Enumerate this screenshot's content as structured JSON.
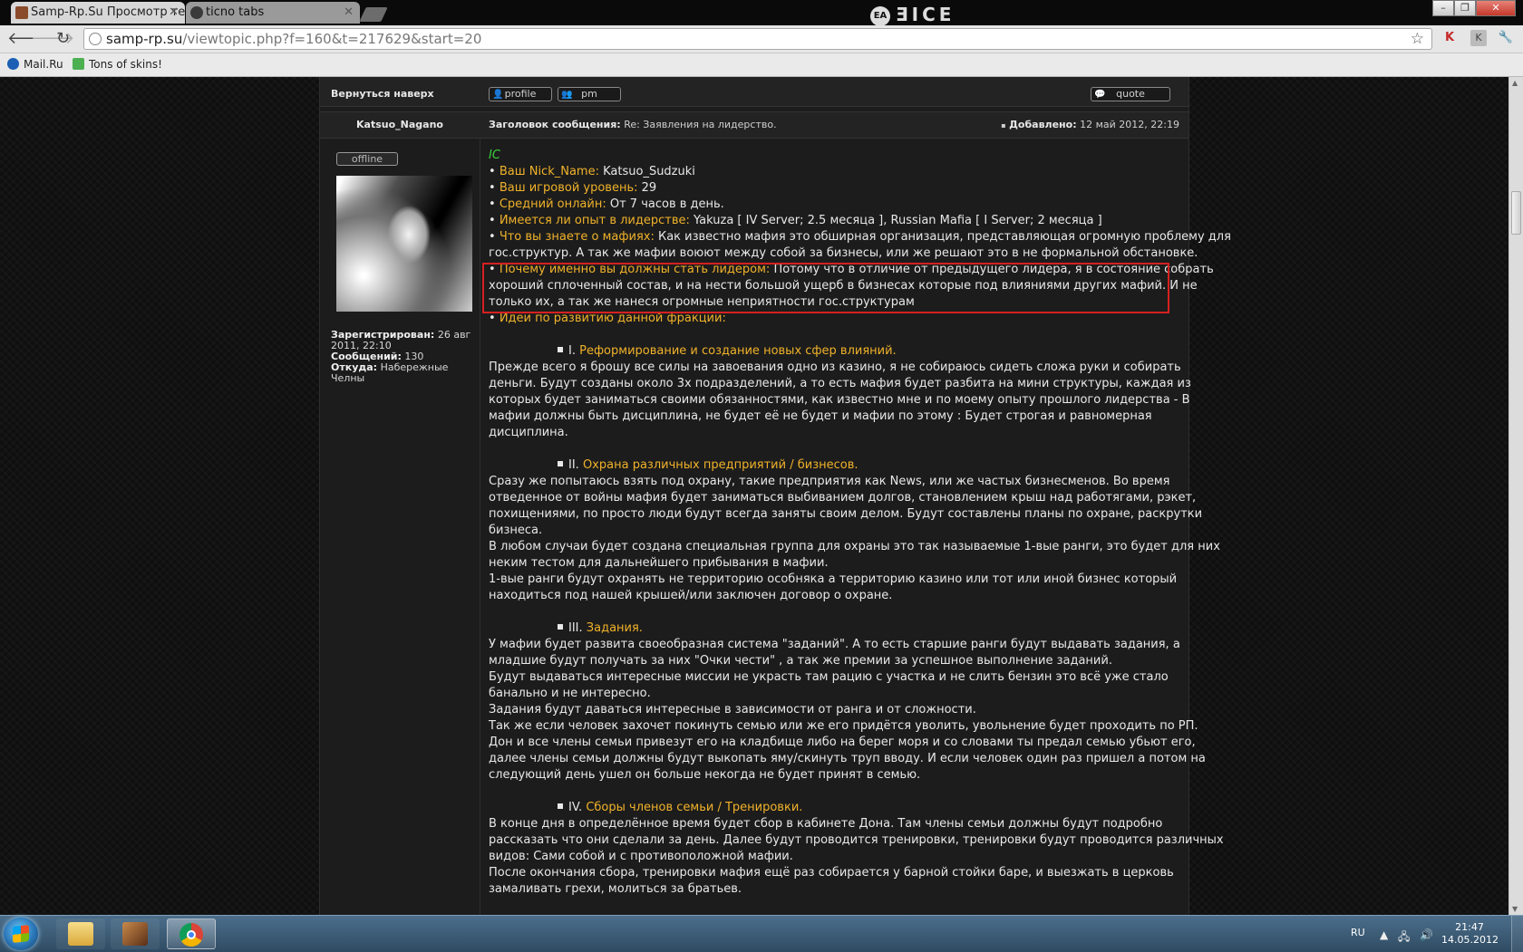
{
  "browser": {
    "tabs": [
      {
        "title": "Samp-Rp.Su Просмотр те",
        "active": true,
        "favicon_color": "#8a4b2a"
      },
      {
        "title": "ticno tabs",
        "active": false,
        "favicon_color": "#3a3a3a"
      }
    ],
    "window_logo": "EA",
    "window_logo_text": "ƎICE",
    "url_host": "samp-rp.su",
    "url_path": "/viewtopic.php?f=160&t=217629&start=20",
    "bookmarks": [
      {
        "label": "Mail.Ru",
        "icon": "mailru-icon",
        "color": "#1a5fb4"
      },
      {
        "label": "Tons of skins!",
        "icon": "speech-bubble-icon",
        "color": "#4caf50"
      }
    ]
  },
  "forum": {
    "back_to_top": "Вернуться наверх",
    "buttons": {
      "profile": "profile",
      "pm": "pm",
      "quote": "quote"
    },
    "post": {
      "author": "Katsuo_Nagano",
      "subject_label": "Заголовок сообщения:",
      "subject": "Re: Заявления на лидерство.",
      "posted_label": "Добавлено:",
      "posted": "12 май 2012, 22:19",
      "status": "offline",
      "registered_label": "Зарегистрирован:",
      "registered": "26 авг 2011, 22:10",
      "posts_label": "Сообщений:",
      "posts": "130",
      "from_label": "Откуда:",
      "from": "Набережные Челны"
    },
    "body": {
      "ic": "IC",
      "fields": [
        {
          "label": "Ваш Nick_Name:",
          "value": " Katsuo_Sudzuki"
        },
        {
          "label": "Ваш игровой уровень:",
          "value": " 29"
        },
        {
          "label": "Средний онлайн:",
          "value": " От 7 часов в день."
        },
        {
          "label": "Имеется ли опыт в лидерстве:",
          "value": " Yakuza [ IV Server; 2.5 месяца ], Russian Mafia [ I Server; 2 месяца ]"
        }
      ],
      "knows_label": "Что вы знаете о мафиях:",
      "knows_1": " Как известно мафия это обширная организация, представляющая огромную проблему для",
      "knows_2": "гос.структур. А так же мафии воюют между собой за бизнесы, или же решают это в не формальной обстановке.",
      "why_label": "Почему именно вы должны стать лидером:",
      "why_1": " Потому что в отличие от предыдущего лидера, я в состояние собрать",
      "why_2": "хороший сплоченный состав, и на нести большой ущерб в бизнесах которые под влияниями других мафий. И не",
      "why_3": "только их, а так же нанеся огромные неприятности гос.структурам",
      "ideas_label": "Идеи по развитию данной фракции:",
      "sections": [
        {
          "num": "I.",
          "title": "Реформирование и создание новых сфер влияний.",
          "lines": [
            "Прежде всего я брошу все силы на завоевания одно из казино, я не собираюсь сидеть сложа руки и собирать",
            "деньги. Будут созданы около 3х подразделений, а то есть мафия будет разбита на мини структуры, каждая из",
            "которых будет заниматься своими обязанностями, как известно мне и по моему опыту прошлого лидерства - В",
            "мафии должны быть дисциплина, не будет её не будет и мафии по этому : Будет строгая и равномерная",
            "дисциплина."
          ]
        },
        {
          "num": "II.",
          "title": "Охрана различных предприятий / бизнесов.",
          "lines": [
            "Сразу же попытаюсь взять под охрану, такие предприятия как News, или же частых бизнесменов. Во время",
            "отведенное от войны мафия будет заниматься выбиванием долгов, становлением крыш над работягами, рэкет,",
            "похищениями, по просто люди будут всегда заняты своим делом. Будут составлены планы по охране, раскрутки",
            "бизнеса.",
            "В любом случаи будет создана специальная группа для охраны это так называемые 1-вые ранги, это будет для них",
            "неким тестом для дальнейшего прибывания в мафии.",
            "1-вые ранги будут охранять не территорию особняка а территорию казино или тот или иной бизнес который",
            "находиться под нашей крышей/или заключен договор о охране."
          ]
        },
        {
          "num": "III.",
          "title": "Задания.",
          "lines": [
            "У мафии будет развита своеобразная система \"заданий\". А то есть старшие ранги будут выдавать задания, а",
            "младшие будут получать за них \"Очки чести\" , а так же премии за успешное выполнение заданий.",
            "Будут выдаваться интересные миссии не украсть там рацию с участка и не слить бензин это всё уже стало",
            "банально и не интересно.",
            "Задания будут даваться интересные в зависимости от ранга и от сложности.",
            "Так же если человек захочет покинуть семью или же его придётся уволить, увольнение будет проходить по РП.",
            "Дон и все члены семьи привезут его на кладбище либо на берег моря и со словами ты предал семью убьют его,",
            "далее члены семьи должны будут выкопать яму/скинуть труп вводу. И если человек один раз пришел а потом на",
            "следующий день ушел он больше некогда не будет принят в семью."
          ]
        },
        {
          "num": "IV.",
          "title": "Сборы членов семьи / Тренировки.",
          "lines": [
            "В конце дня в определённое время будет сбор в кабинете Дона. Там члены семьи должны будут подробно",
            "рассказать что они сделали за день. Далее будут проводится тренировки, тренировки будут проводится различных",
            "видов: Сами собой и с противоположной мафии.",
            "После окончания сбора, тренировки мафия ещё раз собирается у барной стойки баре, и выезжать в церковь",
            "замаливать грехи, молиться за братьев."
          ]
        }
      ]
    }
  },
  "taskbar": {
    "lang": "RU",
    "time": "21:47",
    "date": "14.05.2012"
  },
  "colors": {
    "orange": "#f0b22a",
    "green": "#3bd13b",
    "highlight_border": "#d62020"
  }
}
